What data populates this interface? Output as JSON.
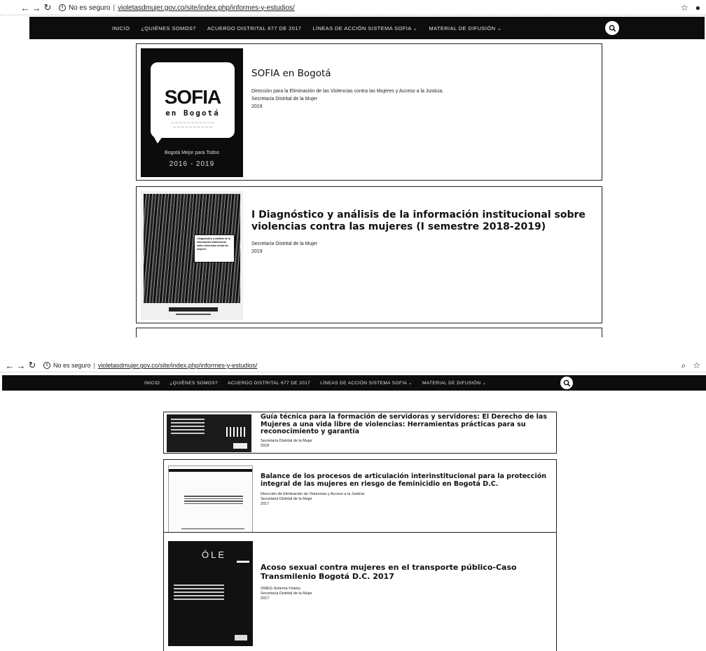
{
  "browser": {
    "not_secure_label": "No es seguro",
    "url": "violetasdmujer.gov.co/site/index.php/informes-y-estudios/"
  },
  "nav": {
    "items": [
      "INICIO",
      "¿QUIÉNES SOMOS?",
      "ACUERDO DISTRITAL 677 DE 2017",
      "LÍNEAS DE ACCIÓN SISTEMA SOFIA ⌄",
      "MATERIAL DE DIFUSIÓN ⌄"
    ]
  },
  "cards": [
    {
      "title": "SOFIA en Bogotá",
      "meta": [
        "Dirección para la Eliminación de las Violencias contra las Mujeres y Acceso a la Justicia.",
        "Secretaría Distrital de la Mujer",
        "2019"
      ],
      "cover": {
        "logo": "SOFIA",
        "city": "en Bogotá",
        "slogan": "Bogotá Mejor para Todos",
        "years": "2016 - 2019"
      }
    },
    {
      "title": "I Diagnóstico y análisis de la información institucional sobre violencias contra las mujeres (I semestre 2018-2019)",
      "meta": [
        "Secretaría Distrital de la Mujer",
        "2019"
      ]
    },
    {
      "title": "Guía técnica para la formación de servidoras y servidores: El Derecho de las Mujeres a una vida libre de violencias: Herramientas prácticas para su reconocimiento y garantía",
      "meta": [
        "Secretaría Distrital de la Mujer",
        "2018"
      ]
    },
    {
      "title": "Balance de los procesos de articulación interinstitucional para la protección integral de las mujeres en riesgo de feminicidio en Bogotá D.C.",
      "meta": [
        "Dirección de Eliminación de Violencias y Acceso a la Justicia",
        "Secretaría Distrital de la Mujer",
        "2017"
      ]
    },
    {
      "title": "Acoso sexual contra mujeres en el transporte público-Caso Transmilenio Bogotá D.C. 2017",
      "meta": [
        "OMEG-Sistema Violeta",
        "Secretaría Distrital de la Mujer",
        "2017"
      ]
    }
  ]
}
